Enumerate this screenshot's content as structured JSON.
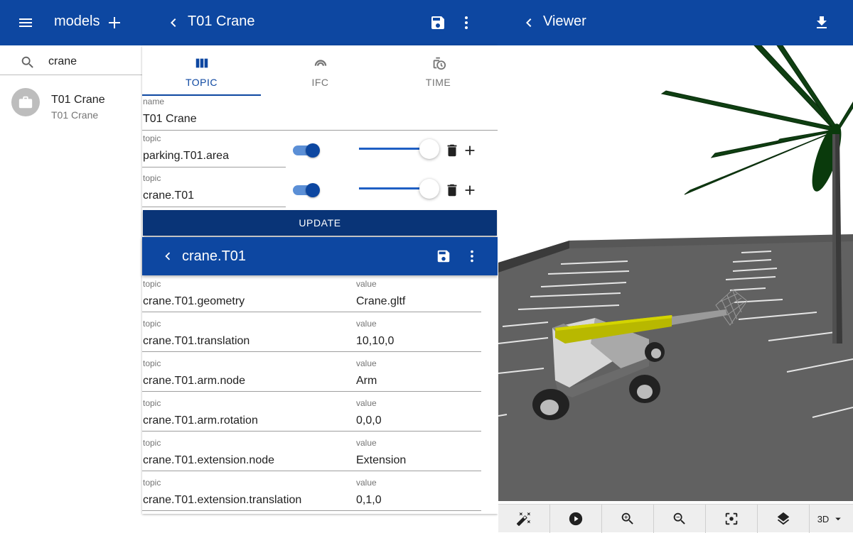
{
  "models_panel": {
    "title": "models",
    "search": {
      "value": "crane",
      "placeholder": ""
    },
    "items": [
      {
        "primary": "T01 Crane",
        "secondary": "T01 Crane"
      }
    ]
  },
  "topic_panel": {
    "title": "T01 Crane",
    "tabs": [
      {
        "label": "TOPIC",
        "icon": "view-column-icon",
        "active": true
      },
      {
        "label": "IFC",
        "icon": "ifc-icon",
        "active": false
      },
      {
        "label": "TIME",
        "icon": "time-history-icon",
        "active": false
      }
    ],
    "name_label": "name",
    "name_value": "T01 Crane",
    "topics": [
      {
        "label": "topic",
        "value": "parking.T01.area",
        "enabled": true,
        "slider_level": 1.0
      },
      {
        "label": "topic",
        "value": "crane.T01",
        "enabled": true,
        "slider_level": 1.0
      }
    ],
    "update_label": "UPDATE",
    "sub_panel": {
      "title": "crane.T01",
      "topic_label": "topic",
      "value_label": "value",
      "rows": [
        {
          "topic": "crane.T01.geometry",
          "value": "Crane.gltf"
        },
        {
          "topic": "crane.T01.translation",
          "value": "10,10,0"
        },
        {
          "topic": "crane.T01.arm.node",
          "value": "Arm"
        },
        {
          "topic": "crane.T01.arm.rotation",
          "value": "0,0,0"
        },
        {
          "topic": "crane.T01.extension.node",
          "value": "Extension"
        },
        {
          "topic": "crane.T01.extension.translation",
          "value": "0,1,0"
        }
      ]
    }
  },
  "viewer_panel": {
    "title": "Viewer",
    "toolbar": {
      "buttons": [
        "magic-wand-icon",
        "play-icon",
        "zoom-in-icon",
        "zoom-out-icon",
        "center-focus-icon",
        "layers-icon"
      ],
      "mode": "3D"
    }
  },
  "colors": {
    "appbar": "#0d47a1",
    "update_button": "#093477",
    "accent": "#0d47a1"
  }
}
